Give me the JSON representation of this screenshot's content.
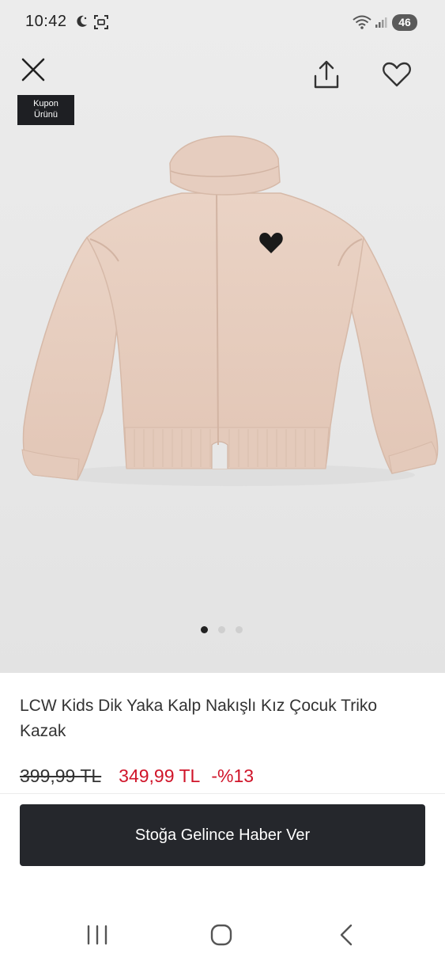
{
  "status_bar": {
    "time": "10:42",
    "battery": "46",
    "icons": [
      "moon-icon",
      "screenshot-icon",
      "wifi-icon",
      "signal-icon",
      "battery-icon"
    ]
  },
  "header": {
    "icons": [
      "close-icon",
      "share-icon",
      "heart-icon"
    ],
    "coupon_badge_line1": "Kupon",
    "coupon_badge_line2": "Ürünü"
  },
  "carousel": {
    "total": 3,
    "active_index": 0
  },
  "product": {
    "title": "LCW Kids Dik Yaka Kalp Nakışlı Kız Çocuk Triko Kazak",
    "old_price": "399,99 TL",
    "new_price": "349,99 TL",
    "discount": "-%13"
  },
  "cta": {
    "label": "Stoğa Gelince Haber Ver"
  },
  "colors": {
    "cta_bg": "#25272c",
    "price_red": "#d0152a",
    "badge_bg": "#1e1f23",
    "sweater": "#e8cfc0"
  },
  "nav": {
    "icons": [
      "recent-apps-icon",
      "home-icon",
      "back-icon"
    ]
  }
}
